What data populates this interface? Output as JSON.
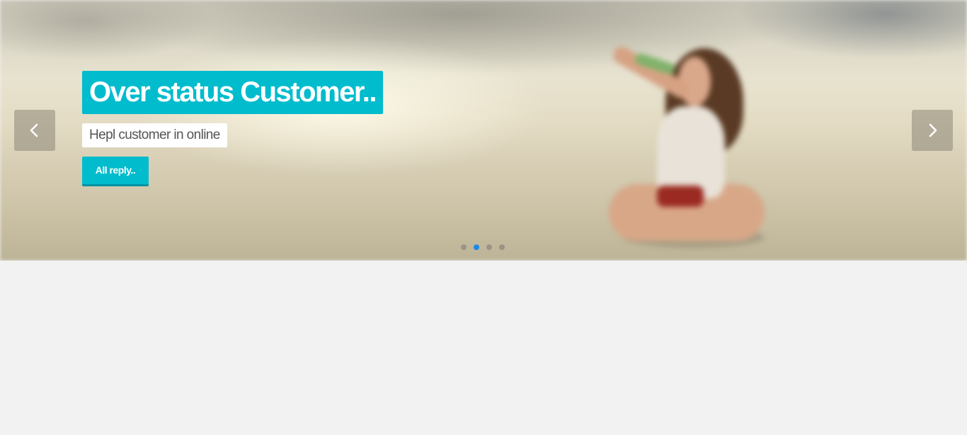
{
  "slider": {
    "caption": {
      "title": "Over status Customer..",
      "subtitle": "Hepl customer in online",
      "button_label": "All reply.."
    },
    "prev_icon": "chevron-left-icon",
    "next_icon": "chevron-right-icon",
    "total_slides": 4,
    "active_slide": 2,
    "colors": {
      "accent": "#00bccd",
      "accent_dark": "#0093a3",
      "active_dot": "#1e88e5",
      "inactive_dot": "#9a9488",
      "page_background": "#f2f2f2"
    }
  }
}
